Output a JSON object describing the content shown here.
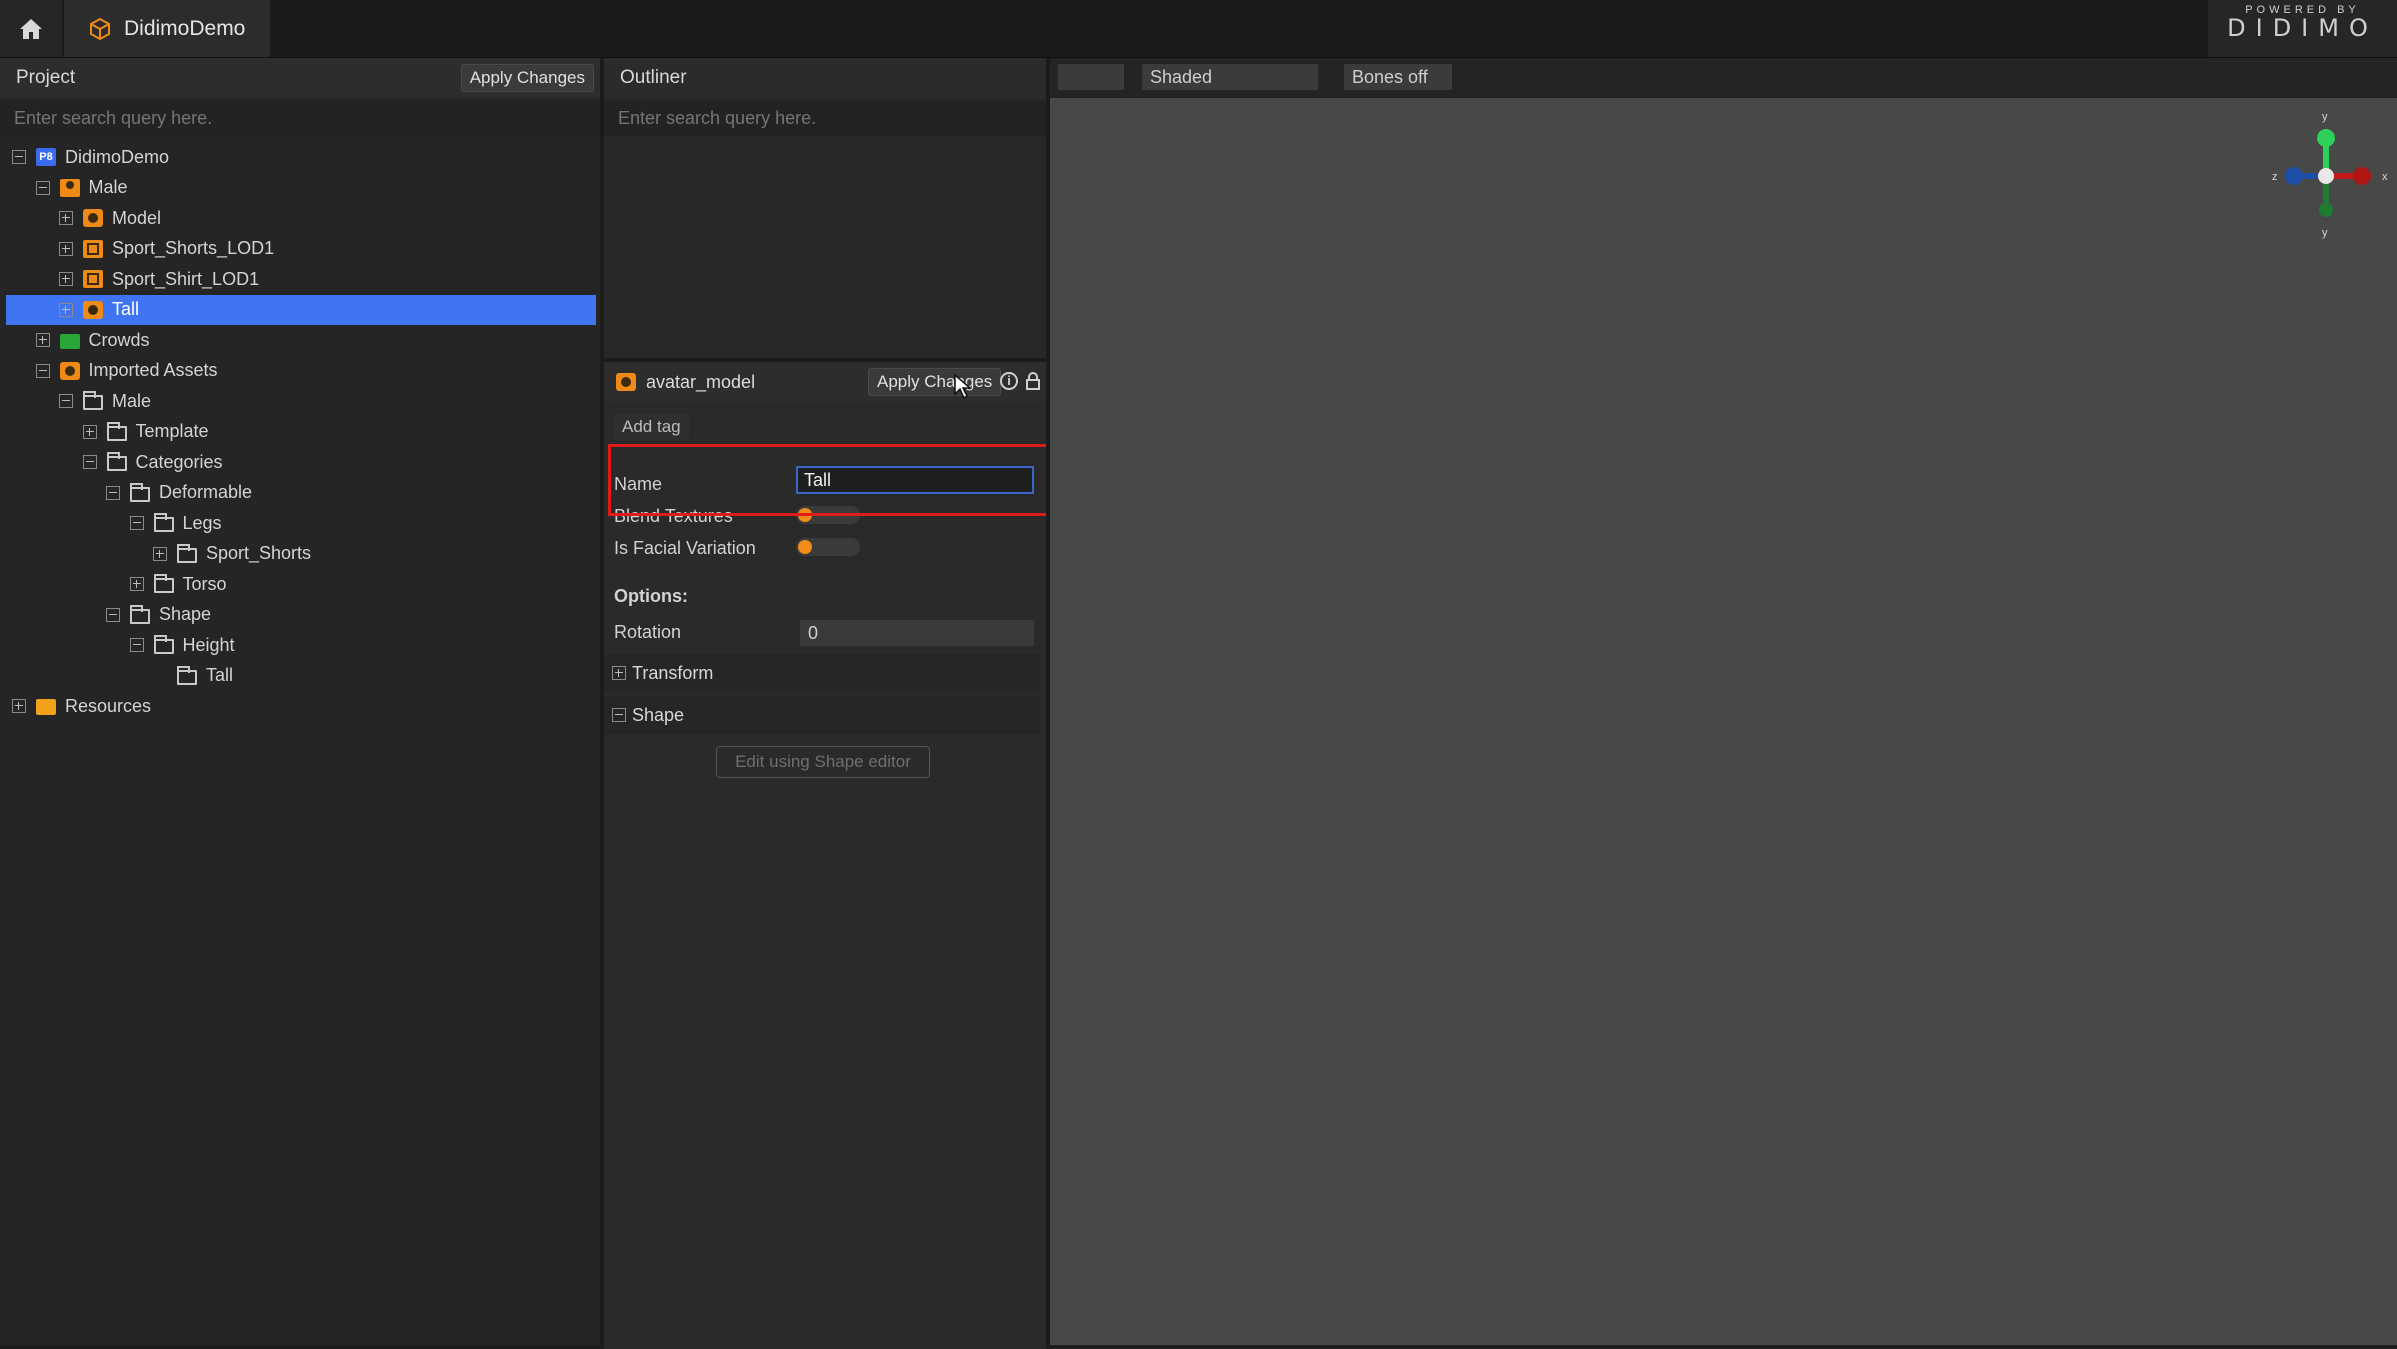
{
  "app": {
    "tab_title": "DidimoDemo",
    "logo_small": "POWERED BY",
    "logo_big": "DIDIMO"
  },
  "project": {
    "title": "Project",
    "apply_label": "Apply Changes",
    "search_placeholder": "Enter search query here.",
    "tree": [
      {
        "label": "DidimoDemo",
        "icon": "project-icon",
        "expander": "minus",
        "depth": 0,
        "selected": false
      },
      {
        "label": "Male",
        "icon": "person-icon",
        "expander": "minus",
        "depth": 1,
        "selected": false
      },
      {
        "label": "Model",
        "icon": "model-icon",
        "expander": "plus",
        "depth": 2,
        "selected": false
      },
      {
        "label": "Sport_Shorts_LOD1",
        "icon": "clothing-icon",
        "expander": "plus",
        "depth": 2,
        "selected": false
      },
      {
        "label": "Sport_Shirt_LOD1",
        "icon": "clothing-icon",
        "expander": "plus",
        "depth": 2,
        "selected": false
      },
      {
        "label": "Tall",
        "icon": "model-icon",
        "expander": "plus",
        "depth": 2,
        "selected": true
      },
      {
        "label": "Crowds",
        "icon": "crowds-folder-icon",
        "expander": "plus",
        "depth": 1,
        "selected": false
      },
      {
        "label": "Imported Assets",
        "icon": "model-icon",
        "expander": "minus",
        "depth": 1,
        "selected": false
      },
      {
        "label": "Male",
        "icon": "folder-icon",
        "expander": "minus",
        "depth": 2,
        "selected": false
      },
      {
        "label": "Template",
        "icon": "folder-icon",
        "expander": "plus",
        "depth": 3,
        "selected": false
      },
      {
        "label": "Categories",
        "icon": "folder-icon",
        "expander": "minus",
        "depth": 3,
        "selected": false
      },
      {
        "label": "Deformable",
        "icon": "folder-icon",
        "expander": "minus",
        "depth": 4,
        "selected": false
      },
      {
        "label": "Legs",
        "icon": "folder-icon",
        "expander": "minus",
        "depth": 5,
        "selected": false
      },
      {
        "label": "Sport_Shorts",
        "icon": "folder-icon",
        "expander": "plus",
        "depth": 6,
        "selected": false
      },
      {
        "label": "Torso",
        "icon": "folder-icon",
        "expander": "plus",
        "depth": 5,
        "selected": false
      },
      {
        "label": "Shape",
        "icon": "folder-icon",
        "expander": "minus",
        "depth": 4,
        "selected": false
      },
      {
        "label": "Height",
        "icon": "folder-icon",
        "expander": "minus",
        "depth": 5,
        "selected": false
      },
      {
        "label": "Tall",
        "icon": "folder-icon",
        "expander": "none",
        "depth": 6,
        "selected": false
      },
      {
        "label": "Resources",
        "icon": "resources-folder-icon",
        "expander": "plus",
        "depth": 0,
        "selected": false
      }
    ]
  },
  "outliner": {
    "title": "Outliner",
    "search_placeholder": "Enter search query here."
  },
  "inspector": {
    "asset_name": "avatar_model",
    "apply_label": "Apply Changes",
    "add_tag_label": "Add tag",
    "name_label": "Name",
    "name_value": "Tall",
    "blend_label": "Blend Textures",
    "blend_on": false,
    "facial_label": "Is Facial Variation",
    "facial_on": false,
    "options_label": "Options:",
    "rotation_label": "Rotation",
    "rotation_value": "0",
    "transform_label": "Transform",
    "shape_label": "Shape",
    "shape_editor_label": "Edit using Shape editor"
  },
  "viewport": {
    "mode_label": "Shaded",
    "bones_label": "Bones off",
    "axes": {
      "x": "x",
      "y": "y",
      "z": "z"
    }
  },
  "colors": {
    "accent": "#3f74f2",
    "orange": "#f08a16",
    "highlight_box": "#e01b1b"
  }
}
